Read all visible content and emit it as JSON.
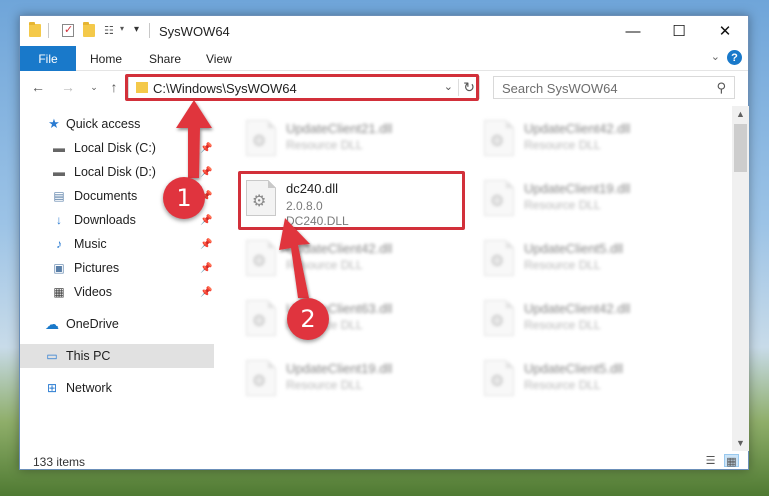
{
  "window": {
    "title": "SysWOW64",
    "controls": {
      "minimize": "—",
      "maximize": "☐",
      "close": "✕"
    }
  },
  "ribbon": {
    "file_tab": "File",
    "tabs": [
      "Home",
      "Share",
      "View"
    ],
    "help": "?"
  },
  "nav": {
    "address": "C:\\Windows\\SysWOW64",
    "search_placeholder": "Search SysWOW64"
  },
  "sidebar": {
    "quick_access": "Quick access",
    "items": [
      {
        "label": "Local Disk (C:)",
        "pinned": true
      },
      {
        "label": "Local Disk (D:)",
        "pinned": true
      },
      {
        "label": "Documents",
        "pinned": true
      },
      {
        "label": "Downloads",
        "pinned": true
      },
      {
        "label": "Music",
        "pinned": true
      },
      {
        "label": "Pictures",
        "pinned": true
      },
      {
        "label": "Videos",
        "pinned": true
      }
    ],
    "onedrive": "OneDrive",
    "this_pc": "This PC",
    "network": "Network"
  },
  "files": {
    "highlighted": {
      "name": "dc240.dll",
      "version": "2.0.8.0",
      "description": "DC240.DLL"
    },
    "blurred": [
      {
        "name": "UpdateClient21.dll",
        "type": "Resource DLL"
      },
      {
        "name": "UpdateClient42.dll",
        "type": "Resource DLL"
      },
      {
        "name": "UpdateClient19.dll",
        "type": "Resource DLL"
      },
      {
        "name": "UpdateClient42.dll",
        "type": "Resource DLL"
      },
      {
        "name": "UpdateClient5.dll",
        "type": "Resource DLL"
      },
      {
        "name": "UpdateClient63.dll",
        "type": "Resource DLL"
      },
      {
        "name": "UpdateClient42.dll",
        "type": "Resource DLL"
      },
      {
        "name": "UpdateClient19.dll",
        "type": "Resource DLL"
      },
      {
        "name": "UpdateClient5.dll",
        "type": "Resource DLL"
      }
    ]
  },
  "status": {
    "count": "133 items"
  },
  "annotations": {
    "step1": "1",
    "step2": "2",
    "color": "#e0343e"
  }
}
